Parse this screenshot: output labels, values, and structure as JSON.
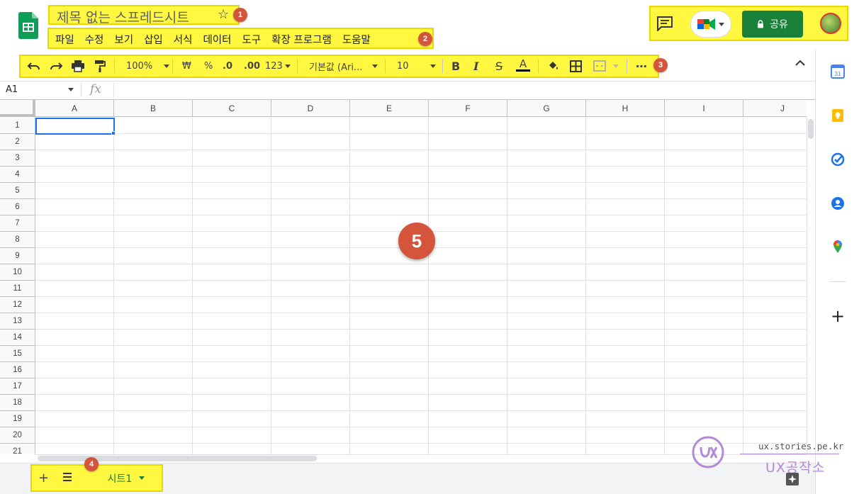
{
  "header": {
    "title": "제목 없는 스프레드시트",
    "menu": [
      "파일",
      "수정",
      "보기",
      "삽입",
      "서식",
      "데이터",
      "도구",
      "확장 프로그램",
      "도움말"
    ],
    "share_label": "공유"
  },
  "badges": {
    "title": "1",
    "menu": "2",
    "toolbar": "3",
    "sheets": "4",
    "grid": "5"
  },
  "toolbar": {
    "zoom": "100%",
    "currency": "₩",
    "percent": "%",
    "decrease_decimal": ".0",
    "increase_decimal": ".00",
    "more_formats": "123",
    "font": "기본값 (Ari...",
    "font_size": "10",
    "bold": "B",
    "italic": "I",
    "strike": "S",
    "text_color": "A",
    "more": "⋯"
  },
  "formula_bar": {
    "cell_ref": "A1",
    "fx": "fx"
  },
  "grid": {
    "columns": [
      "A",
      "B",
      "C",
      "D",
      "E",
      "F",
      "G",
      "H",
      "I",
      "J"
    ],
    "rows": [
      "1",
      "2",
      "3",
      "4",
      "5",
      "6",
      "7",
      "8",
      "9",
      "10",
      "11",
      "12",
      "13",
      "14",
      "15",
      "16",
      "17",
      "18",
      "19",
      "20",
      "21"
    ]
  },
  "sheets": {
    "tabs": [
      "시트1"
    ],
    "add": "+"
  },
  "watermark": {
    "url": "ux.stories.pe.kr",
    "brand": "UX공작소"
  },
  "colors": {
    "accent": "#188038",
    "selection": "#1a73e8",
    "highlight": "#fff740",
    "badge": "#d4553c"
  }
}
